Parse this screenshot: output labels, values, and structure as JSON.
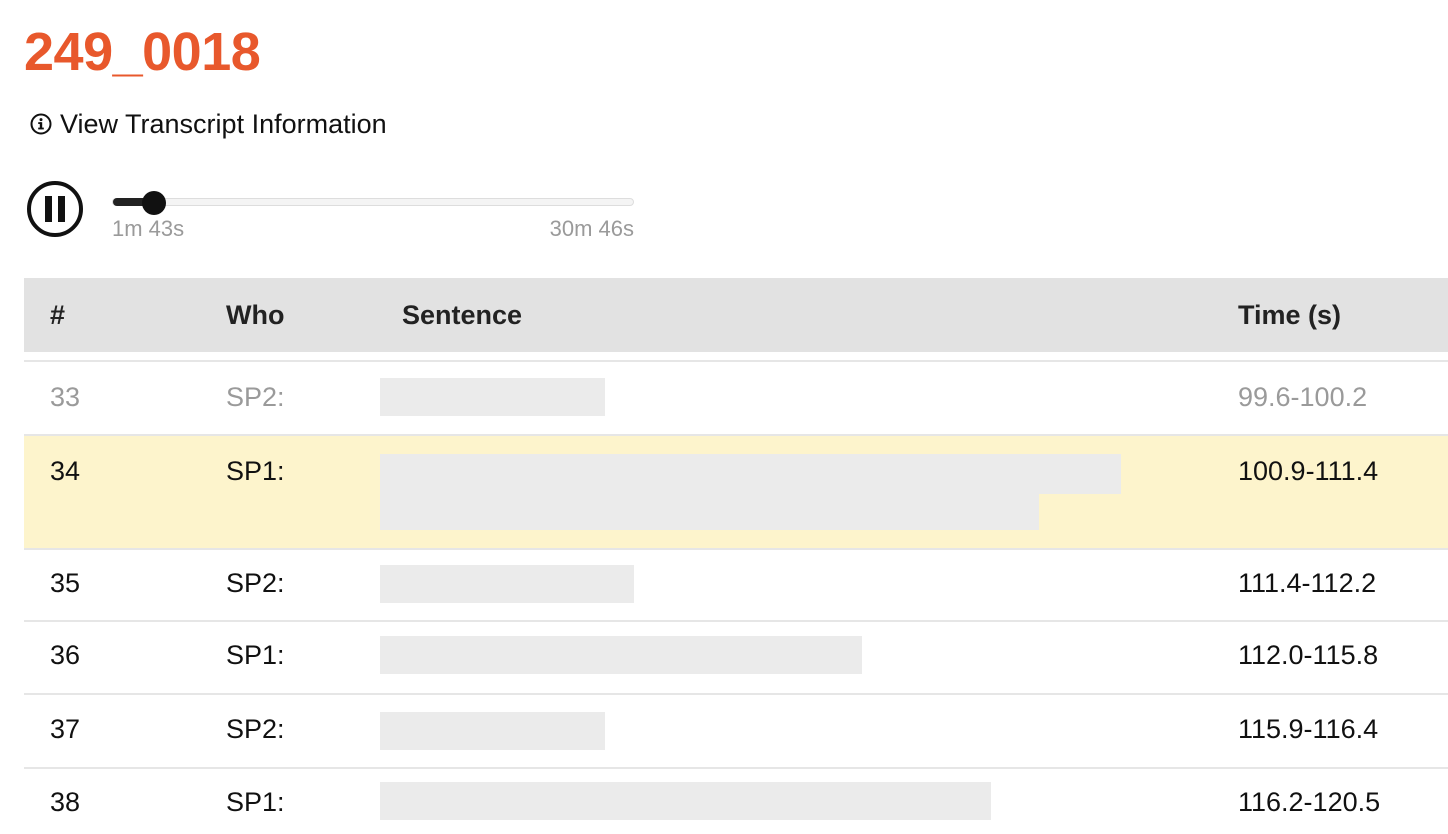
{
  "page": {
    "title": "249_0018",
    "info_link_label": "View Transcript Information"
  },
  "player": {
    "current_time": "1m 43s",
    "total_time": "30m 46s",
    "progress_fraction": 0.056
  },
  "table": {
    "headers": {
      "num": "#",
      "who": "Who",
      "sentence": "Sentence",
      "time": "Time (s)"
    },
    "rows": [
      {
        "num": "33",
        "who": "SP2:",
        "time": "99.6-100.2",
        "state": "past"
      },
      {
        "num": "34",
        "who": "SP1:",
        "time": "100.9-111.4",
        "state": "active"
      },
      {
        "num": "35",
        "who": "SP2:",
        "time": "111.4-112.2",
        "state": "normal"
      },
      {
        "num": "36",
        "who": "SP1:",
        "time": "112.0-115.8",
        "state": "normal"
      },
      {
        "num": "37",
        "who": "SP2:",
        "time": "115.9-116.4",
        "state": "normal"
      },
      {
        "num": "38",
        "who": "SP1:",
        "time": "116.2-120.5",
        "state": "normal"
      }
    ]
  },
  "colors": {
    "title": "#e8582c",
    "active_row": "#fdf4cc",
    "header_bg": "#e2e2e2",
    "redaction": "#ebebeb"
  },
  "icons": {
    "info": "info-circle-icon",
    "pause": "pause-circle-icon"
  }
}
